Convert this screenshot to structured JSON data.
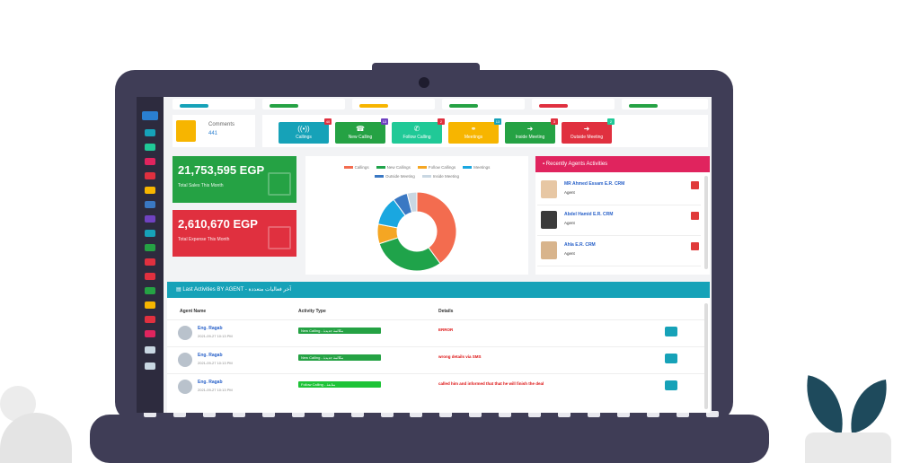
{
  "colors": {
    "laptop": "#3f3d56",
    "green": "#25a244",
    "red": "#e0303f",
    "teal": "#16a2b8",
    "yellow": "#f7b500",
    "pink": "#e0245e"
  },
  "comments": {
    "label": "Comments",
    "count": "441"
  },
  "actions": [
    {
      "label": "Callings",
      "icon": "phone-volume-icon",
      "glyph": "((•))",
      "badge": "40",
      "color": "#16a2b8",
      "badge_color": "#e0303f"
    },
    {
      "label": "New Calling",
      "icon": "phone-box-icon",
      "glyph": "☎",
      "badge": "13",
      "color": "#25a244",
      "badge_color": "#6f42c1"
    },
    {
      "label": "Follow Calling",
      "icon": "phone-icon",
      "glyph": "✆",
      "badge": "2",
      "color": "#20c997",
      "badge_color": "#e0303f"
    },
    {
      "label": "Meetings",
      "icon": "handshake-icon",
      "glyph": "⚭",
      "badge": "13",
      "color": "#f7b500",
      "badge_color": "#16a2b8"
    },
    {
      "label": "Inside Meeting",
      "icon": "door-in-icon",
      "glyph": "➜",
      "badge": "3",
      "color": "#25a244",
      "badge_color": "#e0303f"
    },
    {
      "label": "Outside Meeting",
      "icon": "door-out-icon",
      "glyph": "➜",
      "badge": "2",
      "color": "#e0303f",
      "badge_color": "#20c997"
    }
  ],
  "stats": [
    {
      "value": "21,753,595 EGP",
      "label": "Total Sales This Month",
      "color": "#25a244"
    },
    {
      "value": "2,610,670 EGP",
      "label": "Total Expense This Month",
      "color": "#e0303f"
    }
  ],
  "donut": {
    "legend": [
      {
        "name": "Callings",
        "color": "#f36c4f"
      },
      {
        "name": "New Callings",
        "color": "#1fa34a"
      },
      {
        "name": "Follow Callings",
        "color": "#f5a623"
      },
      {
        "name": "Meetings",
        "color": "#1aa7e0"
      },
      {
        "name": "Outside Meeting",
        "color": "#3a78c3"
      },
      {
        "name": "Inside Meeting",
        "color": "#c9d7e2"
      }
    ],
    "values": [
      40,
      30,
      8,
      12,
      6,
      4
    ]
  },
  "recent": {
    "title": "Recently Agents Activities",
    "agents": [
      {
        "name": "MR Ahmed Essam E.R. CRM",
        "role": "Agent"
      },
      {
        "name": "Abdel Hamid E.R. CRM",
        "role": "Agent"
      },
      {
        "name": "Ahla E.R. CRM",
        "role": "Agent"
      }
    ]
  },
  "activities": {
    "title": "Last Activities BY AGENT - آخر فعاليات متعددة",
    "headers": [
      "Agent Name",
      "Activity Type",
      "Details"
    ],
    "rows": [
      {
        "name": "Eng. Ragab",
        "date": "2021-09-27 10:13 PM",
        "type": "New Calling - مكالمة جديدة",
        "type_color": "#25a244",
        "details": "ERROR"
      },
      {
        "name": "Eng. Ragab",
        "date": "2021-09-27 10:13 PM",
        "type": "New Calling - مكالمة جديدة",
        "type_color": "#25a244",
        "details": "wrong details via SMS"
      },
      {
        "name": "Eng. Ragab",
        "date": "2021-09-27 10:13 PM",
        "type": "Follow Calling - متابعة",
        "type_color": "#1ec337",
        "details": "called him and informed that that he will finish the deal"
      }
    ]
  }
}
